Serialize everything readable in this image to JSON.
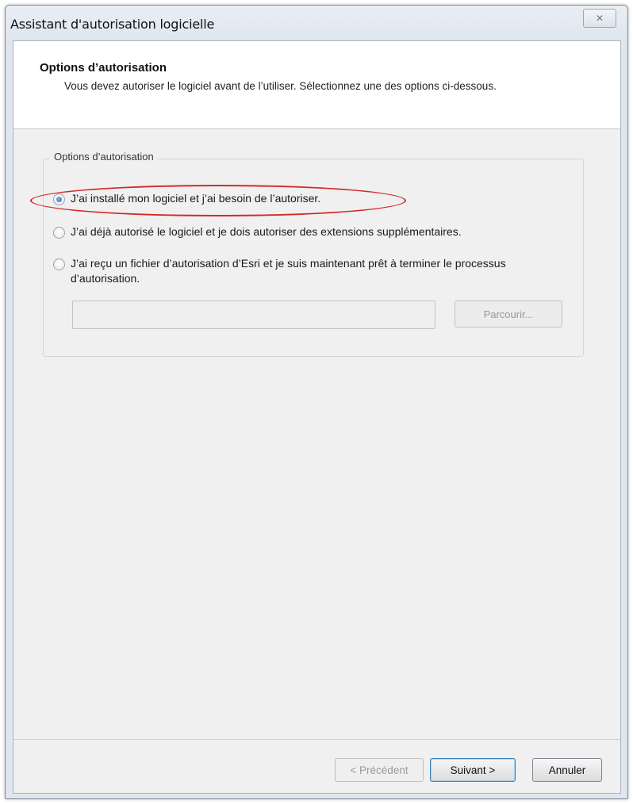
{
  "window": {
    "title": "Assistant d'autorisation logicielle",
    "close_glyph": "✕"
  },
  "header": {
    "title": "Options d’autorisation",
    "description": "Vous devez autoriser le logiciel avant de l’utiliser. Sélectionnez une des options ci-dessous."
  },
  "group": {
    "label": "Options d’autorisation",
    "options": [
      {
        "label": "J’ai installé mon logiciel et j’ai besoin de l’autoriser.",
        "checked": true
      },
      {
        "label": "J’ai déjà autorisé le logiciel et je dois autoriser des extensions supplémentaires.",
        "checked": false
      },
      {
        "label": "J’ai reçu un fichier d’autorisation d’Esri et je suis maintenant prêt à terminer le processus d’autorisation.",
        "checked": false
      }
    ],
    "file_path": "",
    "browse_label": "Parcourir..."
  },
  "footer": {
    "previous_label": "< Précédent",
    "next_label": "Suivant >",
    "cancel_label": "Annuler"
  },
  "colors": {
    "highlight": "#d42a2a",
    "header_bg": "#ffffff",
    "client_bg": "#f0f0f0"
  }
}
